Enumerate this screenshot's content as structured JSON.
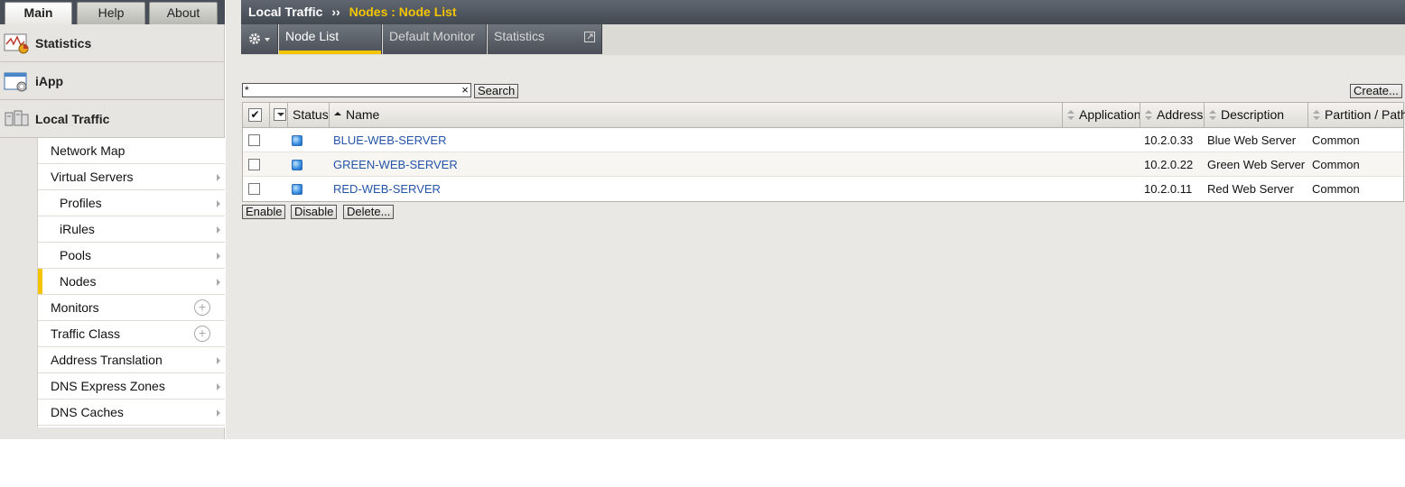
{
  "nav_tabs": [
    "Main",
    "Help",
    "About"
  ],
  "sections": [
    {
      "label": "Statistics",
      "icon": "statistics-icon"
    },
    {
      "label": "iApp",
      "icon": "iapp-icon"
    },
    {
      "label": "Local Traffic",
      "icon": "local-traffic-icon"
    }
  ],
  "menu": [
    {
      "label": "Network Map",
      "level": 0,
      "marker": "none"
    },
    {
      "label": "Virtual Servers",
      "level": 0,
      "marker": "arrow"
    },
    {
      "label": "Profiles",
      "level": 1,
      "marker": "arrow"
    },
    {
      "label": "iRules",
      "level": 1,
      "marker": "arrow"
    },
    {
      "label": "Pools",
      "level": 1,
      "marker": "arrow"
    },
    {
      "label": "Nodes",
      "level": 1,
      "marker": "arrow",
      "selected": true
    },
    {
      "label": "Monitors",
      "level": 0,
      "marker": "plus"
    },
    {
      "label": "Traffic Class",
      "level": 0,
      "marker": "plus"
    },
    {
      "label": "Address Translation",
      "level": 0,
      "marker": "arrow"
    },
    {
      "label": "DNS Express Zones",
      "level": 0,
      "marker": "arrow"
    },
    {
      "label": "DNS Caches",
      "level": 0,
      "marker": "arrow"
    }
  ],
  "breadcrumb": {
    "section": "Local Traffic",
    "separator": "››",
    "current": "Nodes : Node List"
  },
  "subtabs": [
    "Node List",
    "Default Monitor",
    "Statistics"
  ],
  "search": {
    "value": "*",
    "clear": "×",
    "button": "Search"
  },
  "create_button": "Create...",
  "columns": {
    "status": "Status",
    "name": "Name",
    "application": "Application",
    "address": "Address",
    "description": "Description",
    "partition": "Partition / Path"
  },
  "rows": [
    {
      "name": "BLUE-WEB-SERVER",
      "application": "",
      "address": "10.2.0.33",
      "description": "Blue Web Server",
      "partition": "Common"
    },
    {
      "name": "GREEN-WEB-SERVER",
      "application": "",
      "address": "10.2.0.22",
      "description": "Green Web Server",
      "partition": "Common"
    },
    {
      "name": "RED-WEB-SERVER",
      "application": "",
      "address": "10.2.0.11",
      "description": "Red Web Server",
      "partition": "Common"
    }
  ],
  "actions": [
    "Enable",
    "Disable",
    "Delete..."
  ],
  "colors": {
    "accent": "#f5c400",
    "link": "#2654a8",
    "status_available": "#3a8fe0"
  }
}
